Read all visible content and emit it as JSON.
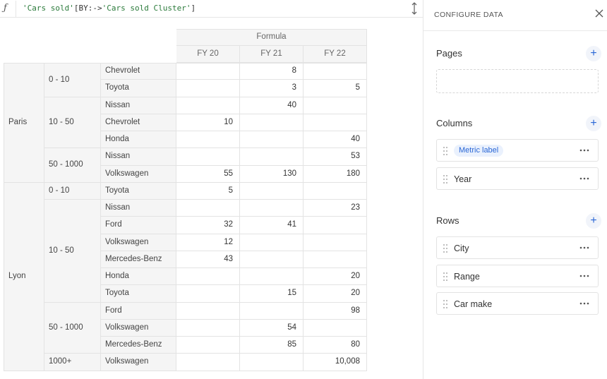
{
  "formula": {
    "icon": "function-icon",
    "part1": "'Cars sold'",
    "part2": "[BY:->",
    "part3": "'Cars sold Cluster'",
    "part4": "]"
  },
  "table": {
    "header_group": "Formula",
    "years": [
      "FY 20",
      "FY 21",
      "FY 22"
    ],
    "rows": [
      {
        "city": "Paris",
        "range": "0 - 10",
        "make": "Chevrolet",
        "fy20": "",
        "fy21": "8",
        "fy22": ""
      },
      {
        "city": "Paris",
        "range": "0 - 10",
        "make": "Toyota",
        "fy20": "",
        "fy21": "3",
        "fy22": "5"
      },
      {
        "city": "Paris",
        "range": "10 - 50",
        "make": "Nissan",
        "fy20": "",
        "fy21": "40",
        "fy22": ""
      },
      {
        "city": "Paris",
        "range": "10 - 50",
        "make": "Chevrolet",
        "fy20": "10",
        "fy21": "",
        "fy22": ""
      },
      {
        "city": "Paris",
        "range": "10 - 50",
        "make": "Honda",
        "fy20": "",
        "fy21": "",
        "fy22": "40"
      },
      {
        "city": "Paris",
        "range": "50 - 1000",
        "make": "Nissan",
        "fy20": "",
        "fy21": "",
        "fy22": "53"
      },
      {
        "city": "Paris",
        "range": "50 - 1000",
        "make": "Volkswagen",
        "fy20": "55",
        "fy21": "130",
        "fy22": "180"
      },
      {
        "city": "Lyon",
        "range": "0 - 10",
        "make": "Toyota",
        "fy20": "5",
        "fy21": "",
        "fy22": ""
      },
      {
        "city": "Lyon",
        "range": "10 - 50",
        "make": "Nissan",
        "fy20": "",
        "fy21": "",
        "fy22": "23"
      },
      {
        "city": "Lyon",
        "range": "10 - 50",
        "make": "Ford",
        "fy20": "32",
        "fy21": "41",
        "fy22": ""
      },
      {
        "city": "Lyon",
        "range": "10 - 50",
        "make": "Volkswagen",
        "fy20": "12",
        "fy21": "",
        "fy22": ""
      },
      {
        "city": "Lyon",
        "range": "10 - 50",
        "make": "Mercedes-Benz",
        "fy20": "43",
        "fy21": "",
        "fy22": ""
      },
      {
        "city": "Lyon",
        "range": "10 - 50",
        "make": "Honda",
        "fy20": "",
        "fy21": "",
        "fy22": "20"
      },
      {
        "city": "Lyon",
        "range": "10 - 50",
        "make": "Toyota",
        "fy20": "",
        "fy21": "15",
        "fy22": "20"
      },
      {
        "city": "Lyon",
        "range": "50 - 1000",
        "make": "Ford",
        "fy20": "",
        "fy21": "",
        "fy22": "98"
      },
      {
        "city": "Lyon",
        "range": "50 - 1000",
        "make": "Volkswagen",
        "fy20": "",
        "fy21": "54",
        "fy22": ""
      },
      {
        "city": "Lyon",
        "range": "50 - 1000",
        "make": "Mercedes-Benz",
        "fy20": "",
        "fy21": "85",
        "fy22": "80"
      },
      {
        "city": "Lyon",
        "range": "1000+",
        "make": "Volkswagen",
        "fy20": "",
        "fy21": "",
        "fy22": "10,008"
      }
    ]
  },
  "panel": {
    "title": "CONFIGURE DATA",
    "pages": {
      "label": "Pages"
    },
    "columns": {
      "label": "Columns",
      "items": [
        "Metric label",
        "Year"
      ]
    },
    "rows": {
      "label": "Rows",
      "items": [
        "City",
        "Range",
        "Car make"
      ]
    }
  },
  "colors": {
    "accent": "#2a67d6",
    "pill_bg": "#eaf1fd",
    "header_bg": "#f5f5f5",
    "border": "#e3e3e3"
  }
}
